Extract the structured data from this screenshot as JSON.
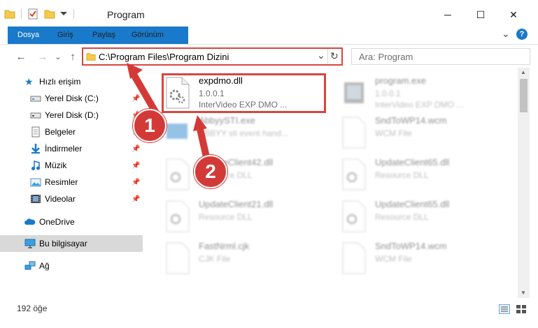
{
  "window": {
    "title": "Program",
    "minimize_glyph": "─",
    "maximize_glyph": "☐",
    "close_glyph": "✕"
  },
  "ribbon": {
    "tabs": [
      "Dosya",
      "Giriş",
      "Paylaş",
      "Görünüm"
    ],
    "expand_glyph": "⌄",
    "help_glyph": "?"
  },
  "address": {
    "path": "C:\\Program Files\\Program Dizini",
    "dropdown_glyph": "⌄",
    "refresh_glyph": "↻",
    "search_placeholder": "Ara: Program",
    "back_glyph": "←",
    "forward_glyph": "→",
    "history_glyph": "⌄",
    "up_glyph": "↑"
  },
  "navigation": {
    "items": [
      {
        "label": "Hızlı erişim",
        "icon": "star-icon"
      },
      {
        "label": "Yerel Disk (C:)",
        "icon": "drive-icon",
        "pinned": true
      },
      {
        "label": "Yerel Disk (D:)",
        "icon": "drive-icon",
        "pinned": true
      },
      {
        "label": "Belgeler",
        "icon": "documents-icon",
        "pinned": true
      },
      {
        "label": "İndirmeler",
        "icon": "download-icon",
        "pinned": true
      },
      {
        "label": "Müzik",
        "icon": "music-icon",
        "pinned": true
      },
      {
        "label": "Resimler",
        "icon": "pictures-icon",
        "pinned": true
      },
      {
        "label": "Videolar",
        "icon": "videos-icon",
        "pinned": true
      },
      {
        "label": "OneDrive",
        "icon": "cloud-icon"
      },
      {
        "label": "Bu bilgisayar",
        "icon": "computer-icon",
        "selected": true
      },
      {
        "label": "Ağ",
        "icon": "network-icon"
      }
    ],
    "pin_glyph": "📌"
  },
  "files": [
    {
      "name": "expdmo.dll",
      "line1": "1.0.0.1",
      "line2": "InterVideo EXP DMO ...",
      "highlighted": true
    },
    {
      "name": "program.exe",
      "line1": "1.0.0.1",
      "line2": "InterVideo EXP DMO ..."
    },
    {
      "name": "AbbyySTI.exe",
      "line1": "ABBYY sti event hand...",
      "line2": ""
    },
    {
      "name": "SndToWP14.wcm",
      "line1": "WCM File",
      "line2": ""
    },
    {
      "name": "UpdateClient42.dll",
      "line1": "Resource DLL",
      "line2": ""
    },
    {
      "name": "UpdateClient65.dll",
      "line1": "Resource DLL",
      "line2": ""
    },
    {
      "name": "UpdateClient21.dll",
      "line1": "Resource DLL",
      "line2": ""
    },
    {
      "name": "UpdateClient65.dll",
      "line1": "Resource DLL",
      "line2": ""
    },
    {
      "name": "FastNrml.cjk",
      "line1": "CJK File",
      "line2": ""
    },
    {
      "name": "SndToWP14.wcm",
      "line1": "WCM File",
      "line2": ""
    }
  ],
  "status": {
    "item_count": "192 öğe"
  },
  "annotations": {
    "marker1": "1",
    "marker2": "2"
  },
  "colors": {
    "accent": "#1979ca",
    "highlight_red": "#d9453f",
    "marker_red": "#d33a37",
    "folder_yellow": "#f6c94c"
  }
}
